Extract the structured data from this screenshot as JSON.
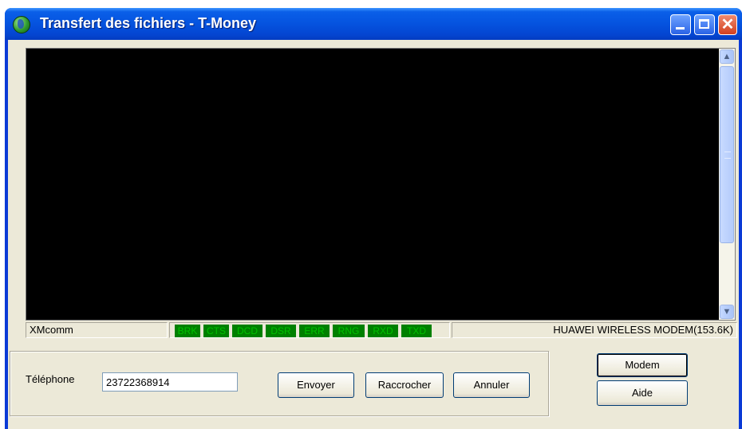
{
  "window": {
    "title": "Transfert des fichiers - T-Money",
    "icon": "globe-app-icon"
  },
  "statusbar": {
    "app": "XMcomm",
    "leds": [
      {
        "label": "BRK"
      },
      {
        "label": "CTS"
      },
      {
        "label": "DCD"
      },
      {
        "label": "DSR"
      },
      {
        "label": "ERR"
      },
      {
        "label": "RNG"
      },
      {
        "label": "RXD"
      },
      {
        "label": "TXD"
      }
    ],
    "modem": "HUAWEI WIRELESS MODEM(153.6K)",
    "led_bg": "#008000",
    "led_text": "#00c000"
  },
  "form": {
    "phone_label": "Téléphone",
    "phone_value": "23722368914"
  },
  "buttons": {
    "envoyer": "Envoyer",
    "raccrocher": "Raccrocher",
    "annuler": "Annuler",
    "modem": "Modem",
    "aide": "Aide"
  }
}
